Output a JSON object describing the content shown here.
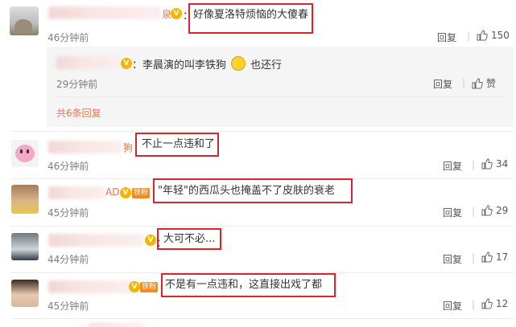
{
  "comments": [
    {
      "text": "好像夏洛特烦恼的大傻春",
      "time": "46分钟前",
      "reply": "回复",
      "likes": "150"
    },
    {
      "text": "不止一点违和了",
      "time": "46分钟前",
      "reply": "回复",
      "likes": "34"
    },
    {
      "text": "\"年轻\"的西瓜头也掩盖不了皮肤的衰老",
      "time": "45分钟前",
      "reply": "回复",
      "likes": "29",
      "name_tail": "AD",
      "fan_badge": "铁粉"
    },
    {
      "text": "大可不必...",
      "time": "44分钟前",
      "reply": "回复",
      "likes": "17"
    },
    {
      "text": "不是有一点违和，这直接出戏了都",
      "time": "45分钟前",
      "reply": "回复",
      "likes": "12",
      "fan_badge": "铁粉"
    }
  ],
  "first_comment": {
    "name_tail": "泉"
  },
  "second_comment": {
    "name_tail": "狗"
  },
  "sub_reply": {
    "text": "：李晨演的叫李铁狗",
    "suffix": "也还行",
    "time": "29分钟前",
    "reply": "回复",
    "like_label": "赞"
  },
  "more_replies": "共6条回复",
  "colors": {
    "highlight": "#d9232d",
    "link": "#eb7350",
    "badge_gold": "#f7b500",
    "fan_orange": "#f58a1f"
  }
}
